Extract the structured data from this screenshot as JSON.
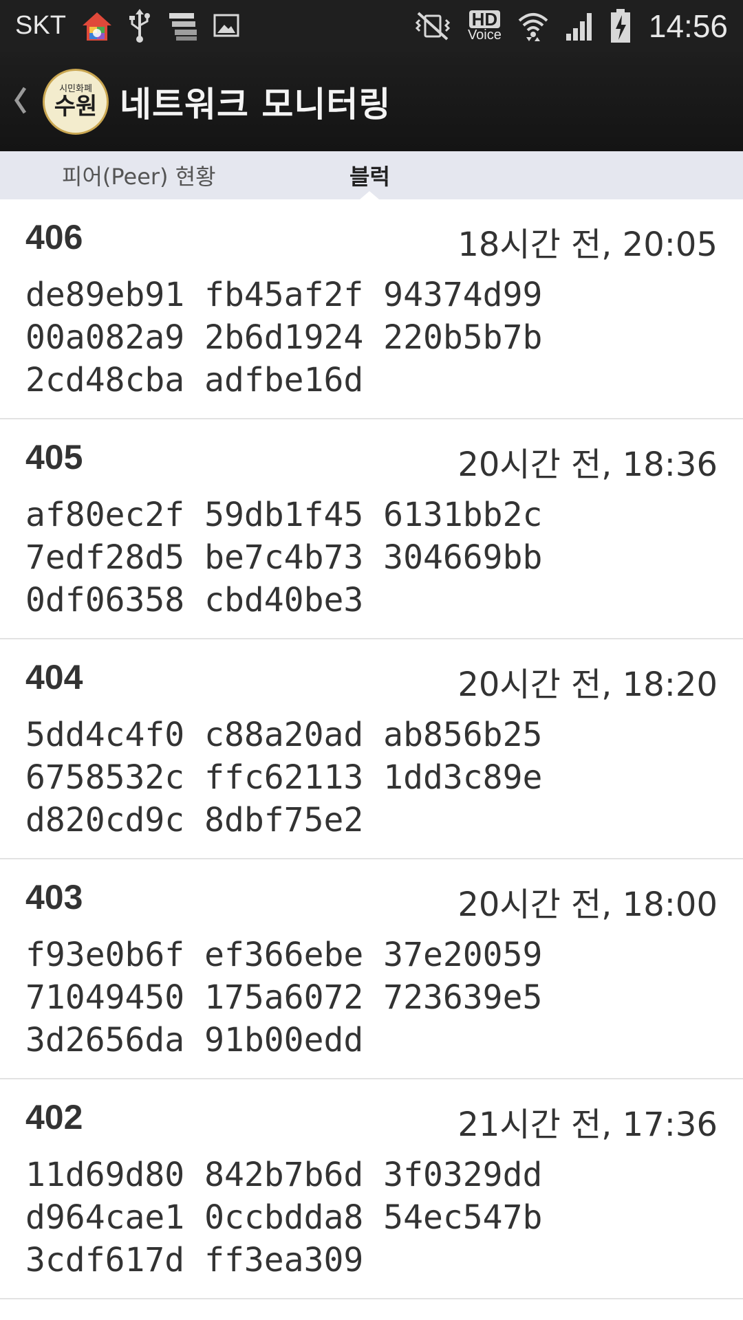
{
  "status_bar": {
    "carrier": "SKT",
    "clock": "14:56",
    "hd": "HD",
    "voice": "Voice",
    "icons": [
      "home-app-icon",
      "usb-icon",
      "notification-stack-icon",
      "image-icon",
      "vibrate-mute-icon",
      "hd-voice-icon",
      "wifi-icon",
      "signal-icon",
      "battery-charging-icon"
    ]
  },
  "app_bar": {
    "logo_small": "시민화폐",
    "logo_big": "수원",
    "title": "네트워크 모니터링"
  },
  "tabs": [
    {
      "label": "피어(Peer) 현황",
      "selected": false
    },
    {
      "label": "블럭",
      "selected": true
    }
  ],
  "blocks": [
    {
      "number": "406",
      "time": "18시간 전, 20:05",
      "hash": [
        "de89eb91 fb45af2f 94374d99",
        "00a082a9 2b6d1924 220b5b7b",
        "2cd48cba adfbe16d"
      ]
    },
    {
      "number": "405",
      "time": "20시간 전, 18:36",
      "hash": [
        "af80ec2f 59db1f45 6131bb2c",
        "7edf28d5 be7c4b73 304669bb",
        "0df06358 cbd40be3"
      ]
    },
    {
      "number": "404",
      "time": "20시간 전, 18:20",
      "hash": [
        "5dd4c4f0 c88a20ad ab856b25",
        "6758532c ffc62113 1dd3c89e",
        "d820cd9c 8dbf75e2"
      ]
    },
    {
      "number": "403",
      "time": "20시간 전, 18:00",
      "hash": [
        "f93e0b6f ef366ebe 37e20059",
        "71049450 175a6072 723639e5",
        "3d2656da 91b00edd"
      ]
    },
    {
      "number": "402",
      "time": "21시간 전, 17:36",
      "hash": [
        "11d69d80 842b7b6d 3f0329dd",
        "d964cae1 0ccbdda8 54ec547b",
        "3cdf617d ff3ea309"
      ]
    }
  ],
  "colors": {
    "status_bar_bg": "#1f1f1f",
    "app_bar_bg": "#1a1a1a",
    "tab_bar_bg": "#e5e7ef",
    "logo_bg": "#f3eccd",
    "text": "#333333"
  }
}
